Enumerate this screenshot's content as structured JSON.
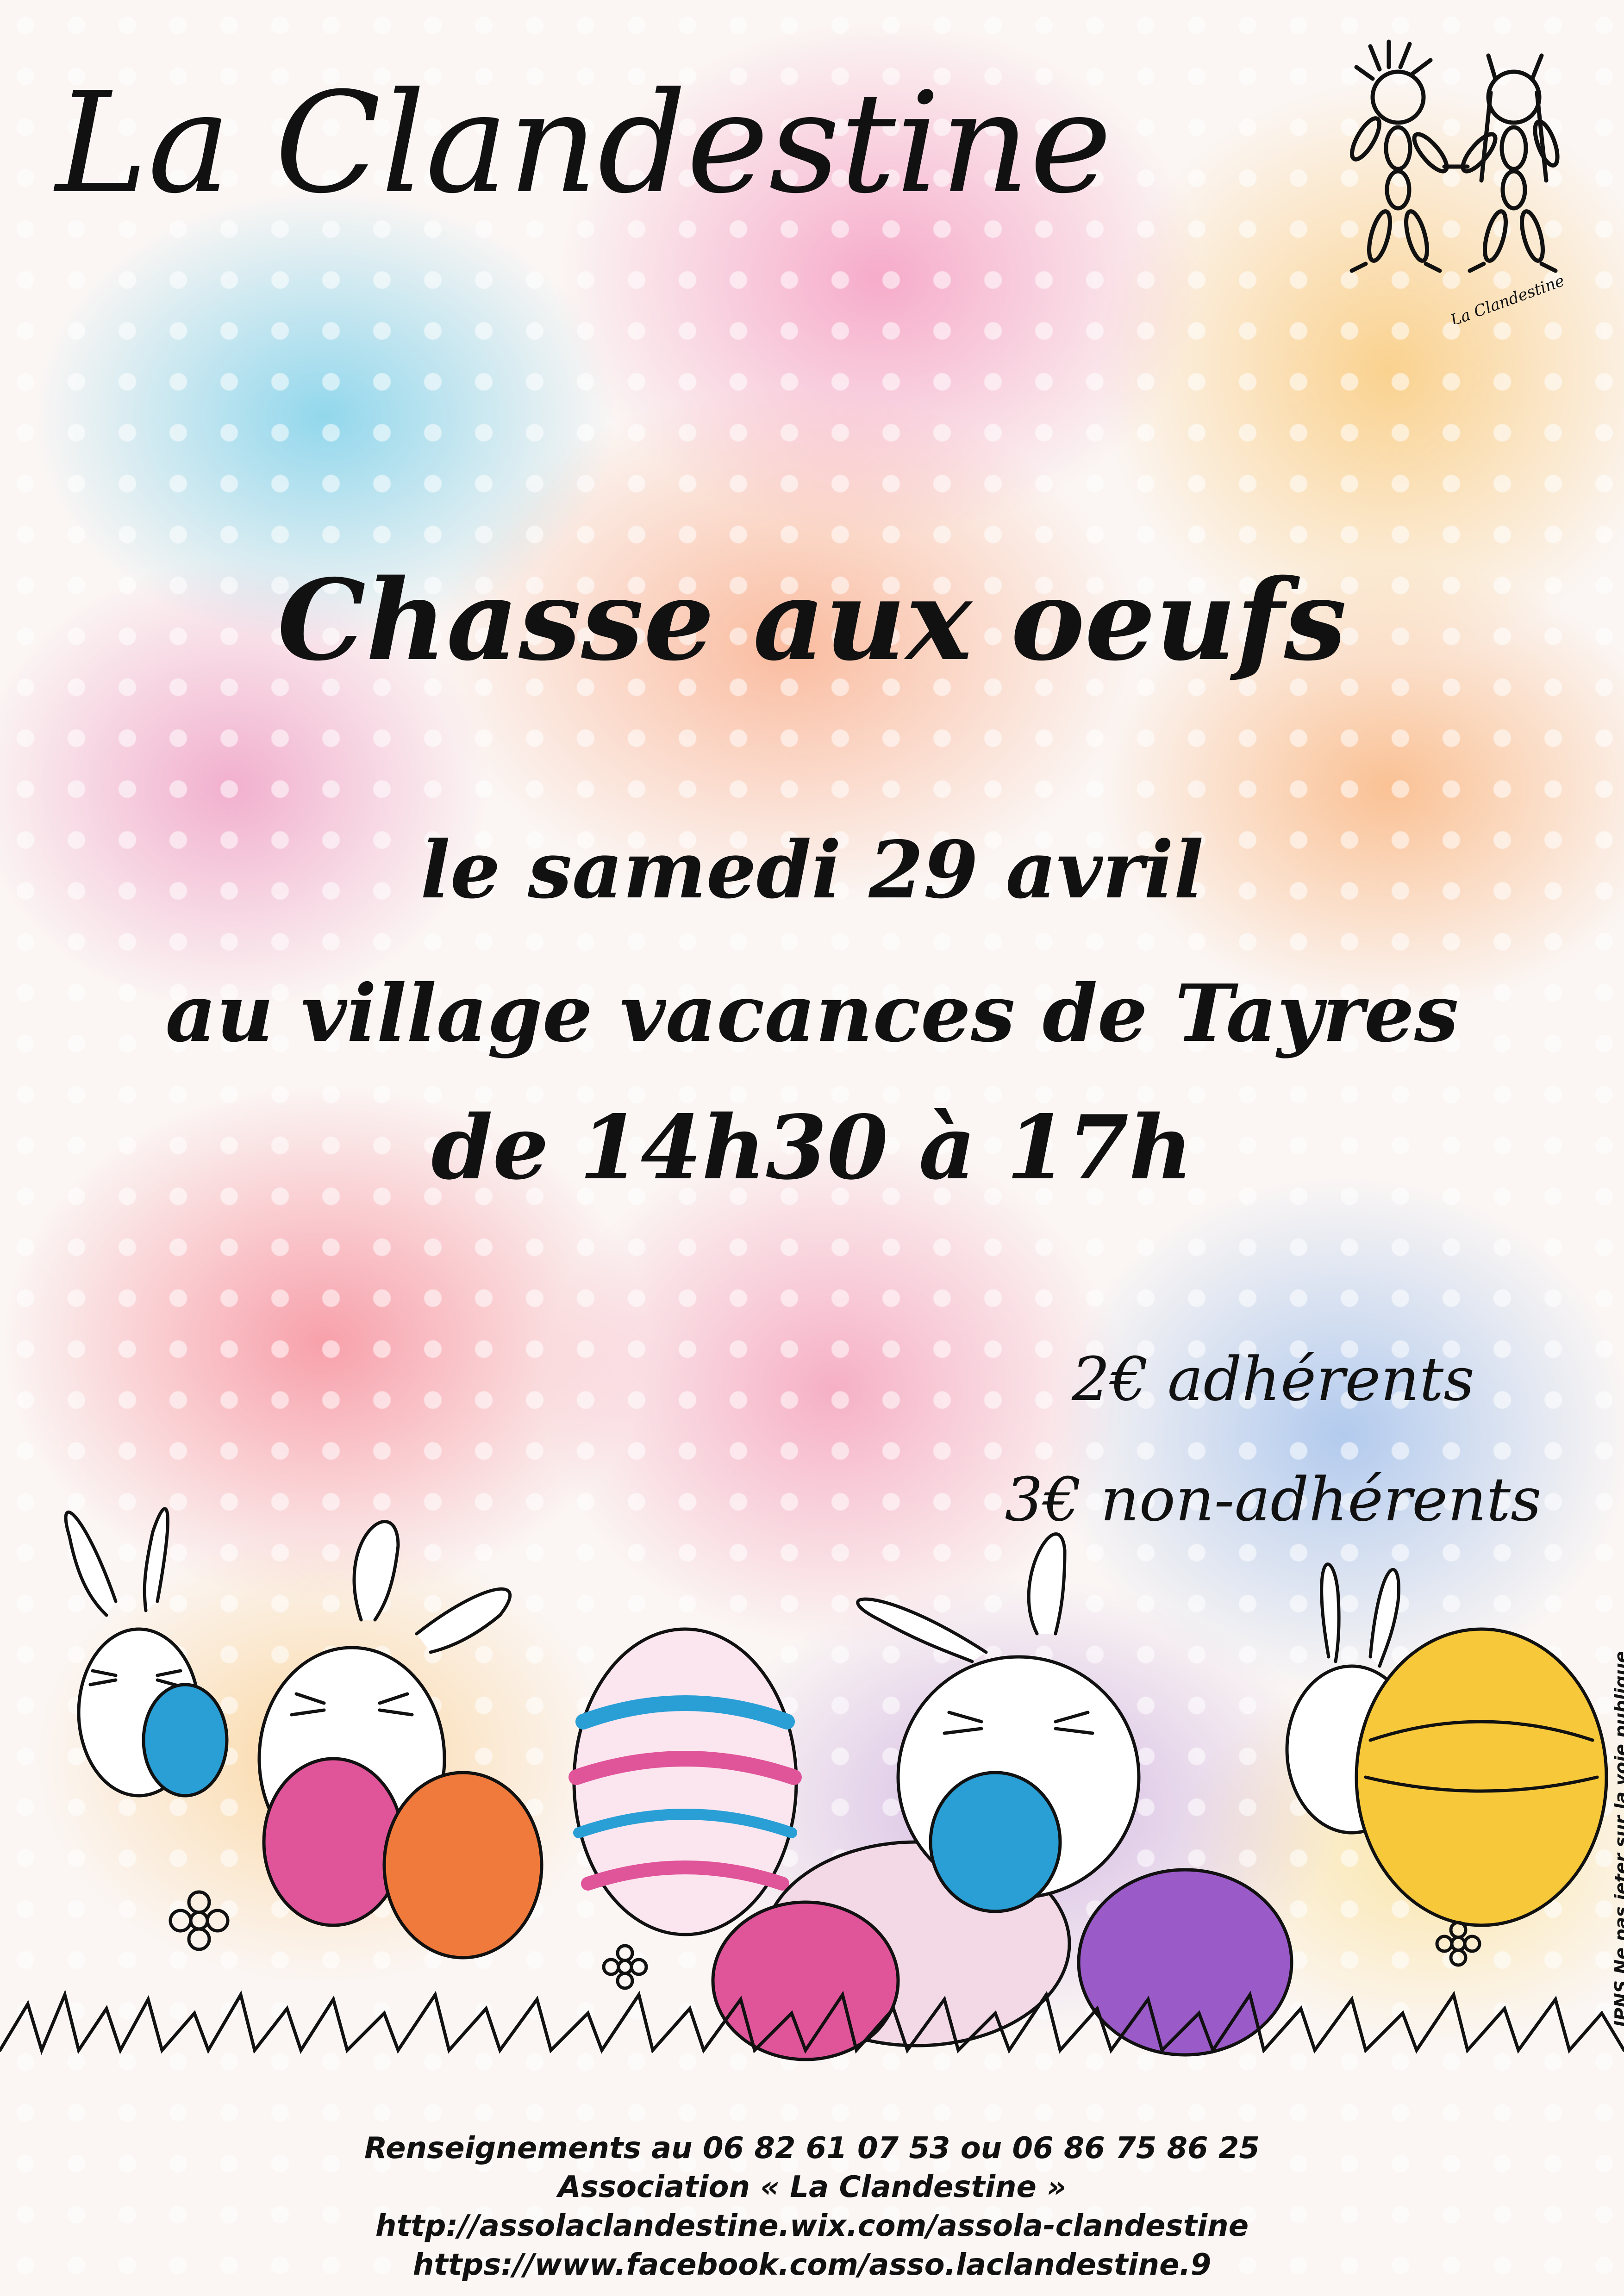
{
  "poster": {
    "organization_title": "La Clandestine",
    "event_title": "Chasse aux oeufs",
    "date_line": "le samedi 29 avril",
    "place_line": "au village vacances de Tayres",
    "time_line": "de 14h30 à 17h",
    "prices": {
      "members": "2€ adhérents",
      "non_members": "3€ non-adhérents"
    },
    "logo_signature": "La Clandestine"
  },
  "footer": {
    "phone_line": "Renseignements au 06 82 61 07 53 ou 06 86 75 86 25",
    "association_line": "Association « La Clandestine »",
    "website": "http://assolaclandestine.wix.com/assola-clandestine",
    "facebook": "https://www.facebook.com/asso.laclandestine.9"
  },
  "side_note": "IPNS Ne pas jeter sur la voie publique",
  "icons": [
    "stick-figures-logo-icon",
    "bunny-icon",
    "easter-egg-icon",
    "flower-icon",
    "grass-icon"
  ],
  "colors": {
    "text": "#111111",
    "cyan_wash": "#3cbee6",
    "pink_wash": "#f05096",
    "orange_wash": "#fa8c5a",
    "yellow_wash": "#fab43c",
    "purple_wash": "#965ac8",
    "egg_blue": "#2a9fd6",
    "egg_pink": "#e0559a",
    "egg_orange": "#f07a3c",
    "egg_yellow": "#f6c83a"
  }
}
